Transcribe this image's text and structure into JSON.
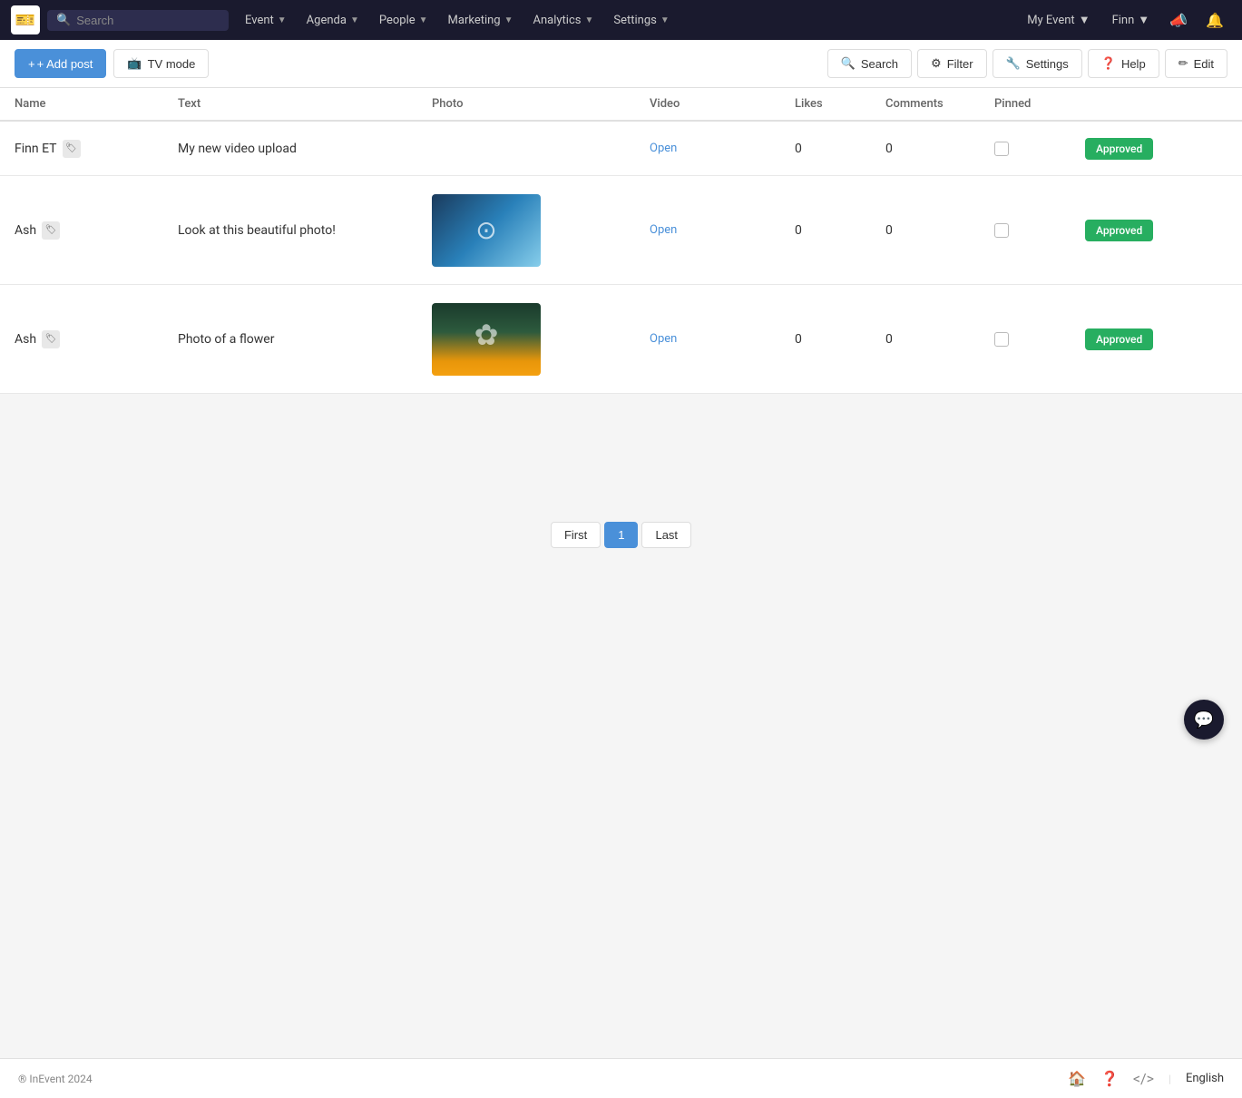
{
  "navbar": {
    "logo": "🎫",
    "search_placeholder": "Search",
    "nav_items": [
      {
        "label": "Event",
        "id": "event"
      },
      {
        "label": "Agenda",
        "id": "agenda"
      },
      {
        "label": "People",
        "id": "people"
      },
      {
        "label": "Marketing",
        "id": "marketing"
      },
      {
        "label": "Analytics",
        "id": "analytics"
      },
      {
        "label": "Settings",
        "id": "settings"
      }
    ],
    "right_items": [
      {
        "label": "My Event",
        "id": "my-event"
      },
      {
        "label": "Finn",
        "id": "finn"
      }
    ]
  },
  "toolbar": {
    "add_post_label": "+ Add post",
    "tv_mode_label": "TV mode",
    "search_label": "Search",
    "filter_label": "Filter",
    "settings_label": "Settings",
    "help_label": "Help",
    "edit_label": "Edit"
  },
  "table": {
    "columns": [
      "Name",
      "Text",
      "Photo",
      "Video",
      "Likes",
      "Comments",
      "Pinned",
      ""
    ],
    "rows": [
      {
        "name": "Finn ET",
        "text": "My new video upload",
        "photo": null,
        "video": "Open",
        "likes": "0",
        "comments": "0",
        "pinned": false,
        "status": "Approved"
      },
      {
        "name": "Ash",
        "text": "Look at this beautiful photo!",
        "photo": "camera",
        "video": "Open",
        "likes": "0",
        "comments": "0",
        "pinned": false,
        "status": "Approved"
      },
      {
        "name": "Ash",
        "text": "Photo of a flower",
        "photo": "dandelion",
        "video": "Open",
        "likes": "0",
        "comments": "0",
        "pinned": false,
        "status": "Approved"
      }
    ]
  },
  "pagination": {
    "first_label": "First",
    "current_page": "1",
    "last_label": "Last"
  },
  "footer": {
    "copyright": "® InEvent 2024",
    "language": "English"
  }
}
